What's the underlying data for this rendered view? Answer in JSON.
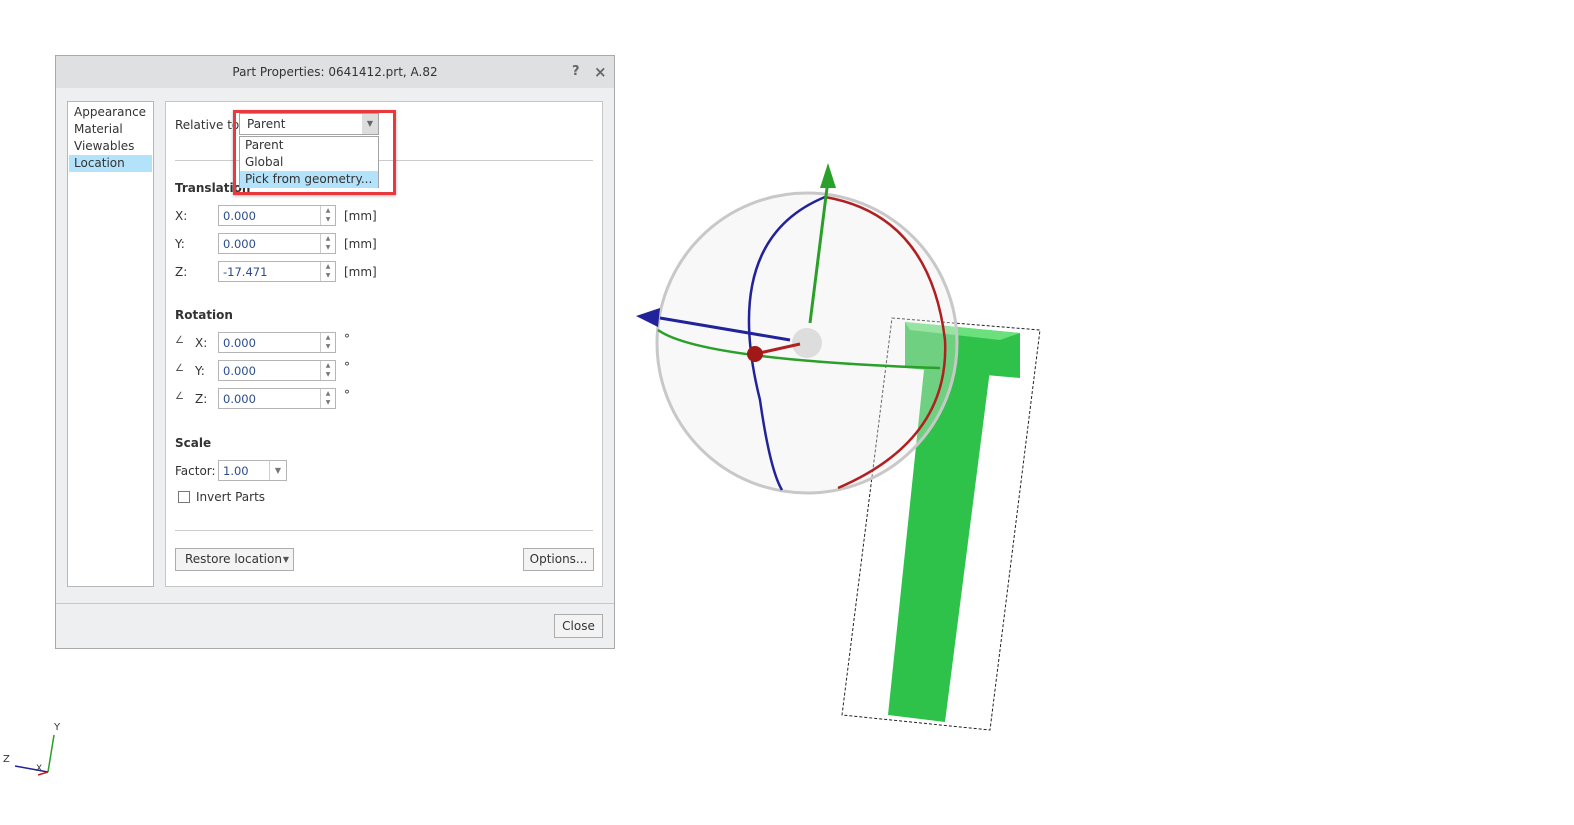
{
  "dialog": {
    "title": "Part Properties: 0641412.prt, A.82",
    "help_icon": "?",
    "close_icon": "×"
  },
  "sidebar": {
    "items": [
      {
        "label": "Appearance"
      },
      {
        "label": "Material"
      },
      {
        "label": "Viewables"
      },
      {
        "label": "Location",
        "selected": true
      }
    ]
  },
  "relative_to": {
    "label": "Relative to:",
    "value": "Parent",
    "options": [
      "Parent",
      "Global",
      "Pick from geometry..."
    ],
    "highlighted": "Pick from geometry..."
  },
  "translation": {
    "header": "Translation",
    "x_label": "X:",
    "x": "0.000",
    "y_label": "Y:",
    "y": "0.000",
    "z_label": "Z:",
    "z": "-17.471",
    "unit": "[mm]"
  },
  "rotation": {
    "header": "Rotation",
    "x_label": "X:",
    "x": "0.000",
    "y_label": "Y:",
    "y": "0.000",
    "z_label": "Z:",
    "z": "0.000",
    "unit": "°"
  },
  "scale": {
    "header": "Scale",
    "factor_label": "Factor:",
    "factor": "1.00",
    "invert_label": "Invert Parts",
    "invert_checked": false
  },
  "buttons": {
    "restore": "Restore location",
    "options": "Options...",
    "close": "Close"
  },
  "triad": {
    "y": "Y",
    "z": "Z",
    "x": "X"
  },
  "colors": {
    "highlight": "#b3e2fb",
    "annotation": "#e8393f",
    "part": "#2ec24a"
  }
}
